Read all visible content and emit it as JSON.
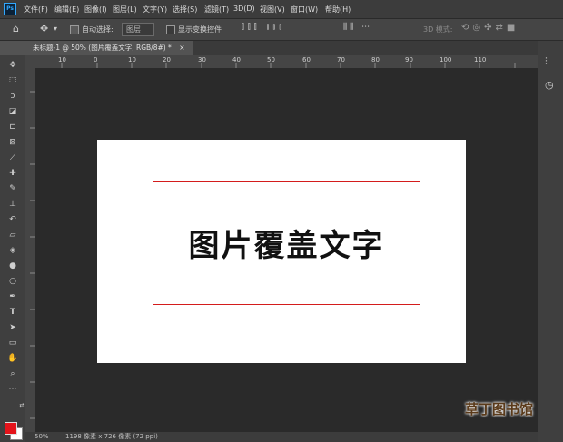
{
  "app": {
    "logo": "Ps"
  },
  "menu": [
    "文件(F)",
    "编辑(E)",
    "图像(I)",
    "图层(L)",
    "文字(Y)",
    "选择(S)",
    "滤镜(T)",
    "3D(D)",
    "视图(V)",
    "窗口(W)",
    "帮助(H)"
  ],
  "options": {
    "auto_select_label": "自动选择:",
    "auto_select_value": "图层",
    "transform_controls_label": "显示变换控件",
    "mode_3d_label": "3D 模式:"
  },
  "tab": {
    "title": "未标题-1 @ 50% (图片覆盖文字, RGB/8#) *",
    "close": "×"
  },
  "ruler": {
    "h_ticks": [
      "10",
      "0",
      "10",
      "20",
      "30",
      "40",
      "50",
      "60",
      "70",
      "80",
      "90",
      "100",
      "110"
    ]
  },
  "canvas": {
    "text": "图片覆盖文字"
  },
  "status": {
    "zoom": "50%",
    "doc_info": "1198 像素 x 726 像素 (72 ppi)"
  },
  "watermark": "草丁图书馆",
  "colors": {
    "foreground": "#e4141b",
    "background": "#ffffff",
    "frame": "#d41c1c"
  }
}
